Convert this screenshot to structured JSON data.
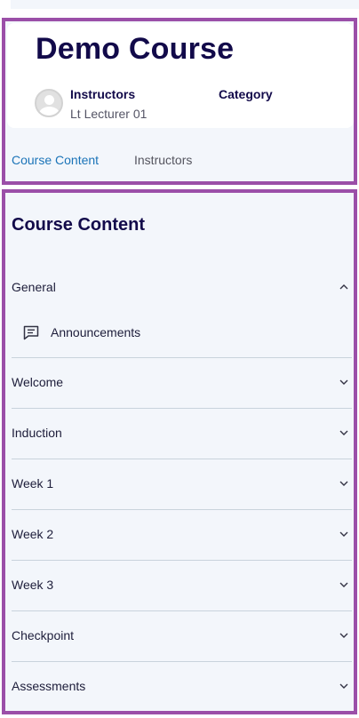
{
  "course": {
    "title": "Demo Course",
    "instructors_label": "Instructors",
    "category_label": "Category",
    "instructor_name": "Lt Lecturer 01"
  },
  "tabs": [
    {
      "label": "Course Content",
      "active": true
    },
    {
      "label": "Instructors",
      "active": false
    }
  ],
  "content": {
    "heading": "Course Content",
    "sections": [
      {
        "label": "General",
        "expanded": true,
        "icon": "chevron-up-icon"
      },
      {
        "label": "Welcome",
        "expanded": false,
        "icon": "chevron-down-icon"
      },
      {
        "label": "Induction",
        "expanded": false,
        "icon": "chevron-down-icon"
      },
      {
        "label": "Week 1",
        "expanded": false,
        "icon": "chevron-down-icon"
      },
      {
        "label": "Week 2",
        "expanded": false,
        "icon": "chevron-down-icon"
      },
      {
        "label": "Week 3",
        "expanded": false,
        "icon": "chevron-down-icon"
      },
      {
        "label": "Checkpoint",
        "expanded": false,
        "icon": "chevron-down-icon"
      },
      {
        "label": "Assessments",
        "expanded": false,
        "icon": "chevron-down-icon"
      }
    ],
    "general_activities": [
      {
        "label": "Announcements",
        "icon": "forum-icon"
      }
    ]
  },
  "colors": {
    "highlight_border": "#9b4fa8",
    "title_navy": "#120a4a",
    "active_tab": "#1b74b8",
    "panel_bg": "#f3f6fb"
  }
}
